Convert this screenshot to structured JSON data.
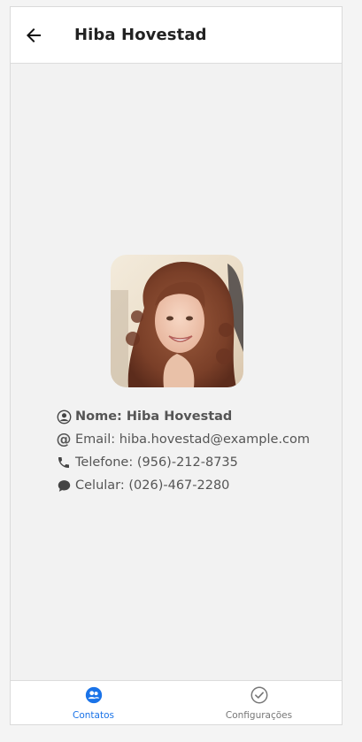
{
  "header": {
    "title": "Hiba Hovestad"
  },
  "contact": {
    "name_line": "Nome: Hiba Hovestad",
    "email_line": "Email: hiba.hovestad@example.com",
    "phone_line": "Telefone: (956)-212-8735",
    "cell_line": "Celular: (026)-467-2280"
  },
  "tabs": [
    {
      "label": "Contatos",
      "icon": "contacts-icon",
      "active": true
    },
    {
      "label": "Configurações",
      "icon": "check-circle-icon",
      "active": false
    }
  ],
  "colors": {
    "accent": "#1a73e8",
    "background": "#f2f2f2",
    "header_bg": "#ffffff",
    "text": "#555555"
  }
}
